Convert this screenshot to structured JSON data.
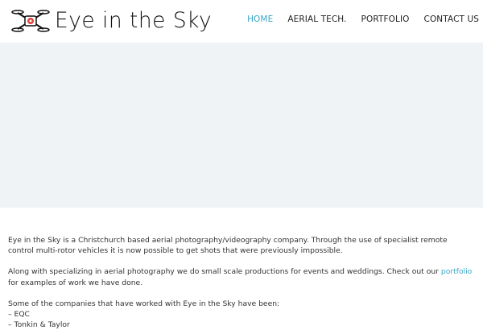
{
  "site": {
    "brand_name": "Eye in the Sky",
    "accent_color": "#3aa6c9",
    "logo_icon": "drone-icon"
  },
  "nav": {
    "items": [
      {
        "label": "HOME",
        "active": true
      },
      {
        "label": "AERIAL TECH.",
        "active": false
      },
      {
        "label": "PORTFOLIO",
        "active": false
      },
      {
        "label": "CONTACT US",
        "active": false
      }
    ]
  },
  "content": {
    "intro": "Eye in the Sky is a Christchurch based aerial photography/videography company. Through the use of specialist remote control multi-rotor vehicles it is now possible to get shots that were previously impossible.",
    "para2_before": "Along with specializing in aerial photography we do small scale productions for events and weddings. Check out our ",
    "para2_link": "portfolio",
    "para2_after": " for examples of work we have done.",
    "companies_heading": "Some of the companies that have worked with Eye in the Sky have been:",
    "companies": [
      "– EQC",
      "– Tonkin & Taylor"
    ]
  }
}
